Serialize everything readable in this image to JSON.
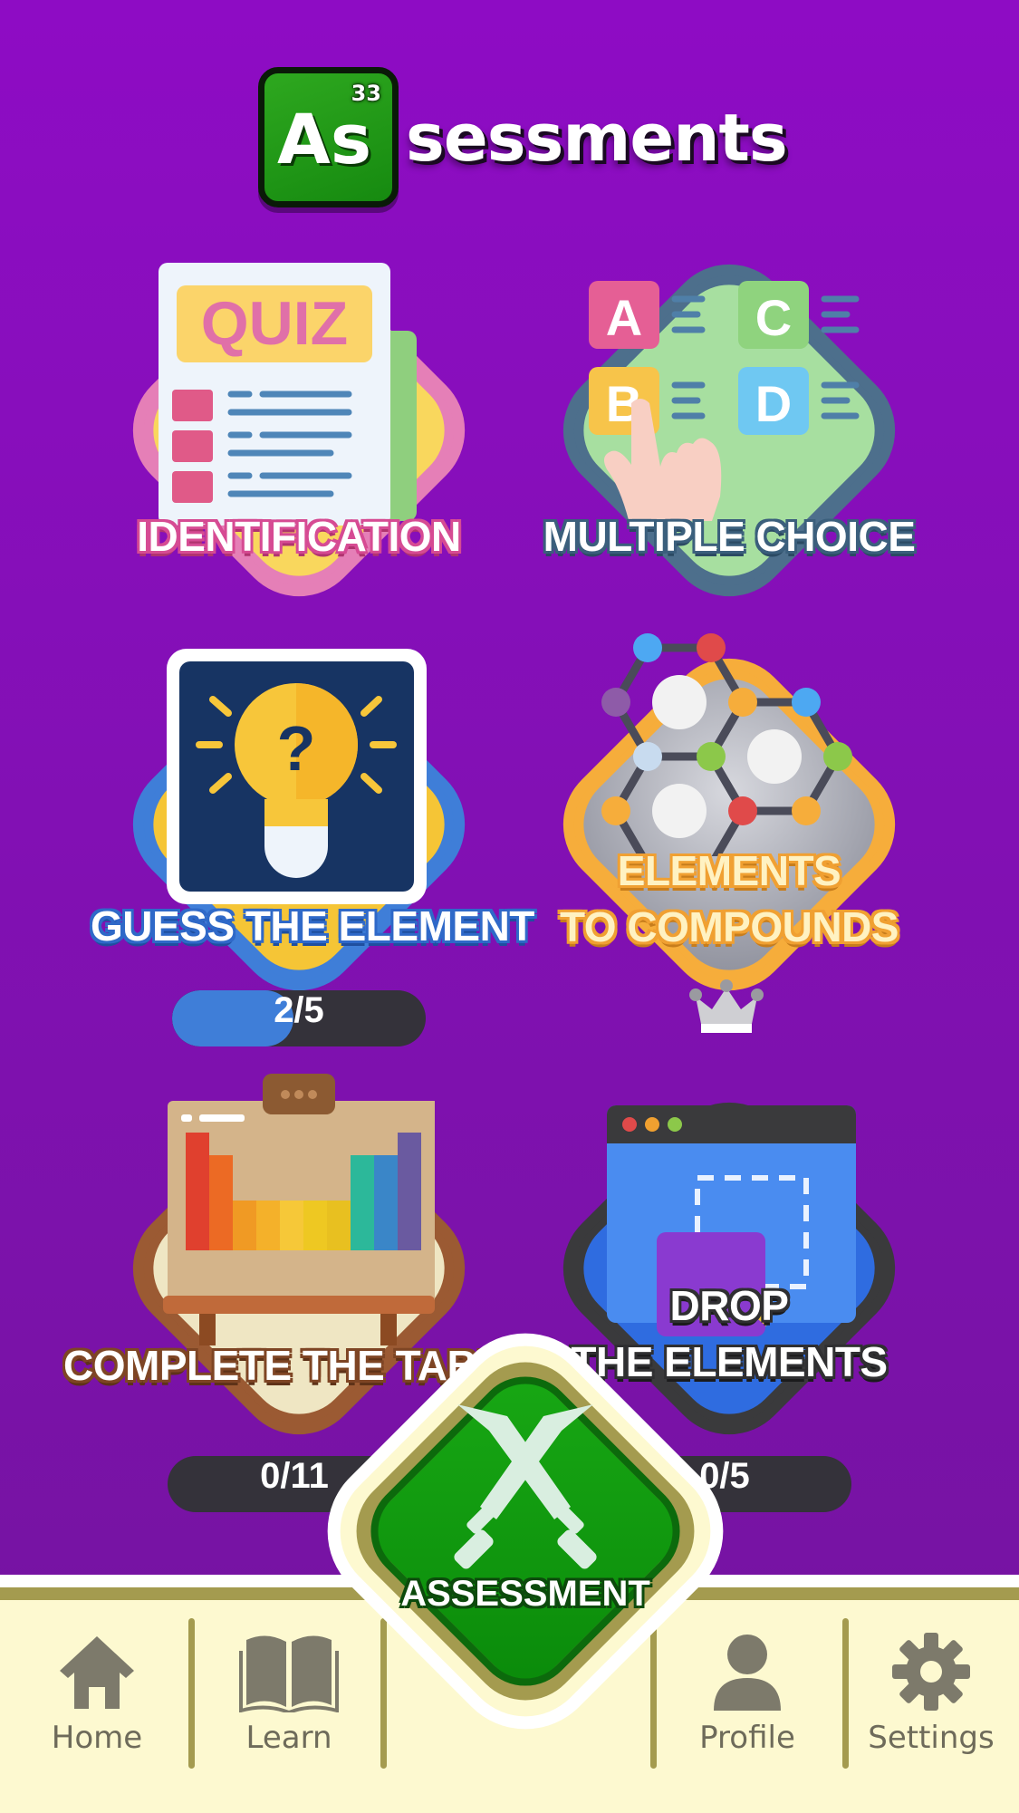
{
  "header": {
    "element_number": "33",
    "element_symbol": "As",
    "title_rest": "sessments"
  },
  "modes": {
    "identification": {
      "label": "IDENTIFICATION"
    },
    "multiple_choice": {
      "label": "MULTIPLE CHOICE"
    },
    "guess_element": {
      "label": "GUESS THE ELEMENT",
      "progress_text": "2/5",
      "progress": 0.4
    },
    "compounds": {
      "label_line1": "ELEMENTS",
      "label_line2": "TO COMPOUNDS",
      "locked": true
    },
    "complete_table": {
      "label": "COMPLETE THE TABLE",
      "progress_text": "0/11",
      "progress": 0
    },
    "drop_elements": {
      "label_line1": "DROP",
      "label_line2": "THE ELEMENTS",
      "progress_text": "0/5",
      "progress": 0
    }
  },
  "nav": {
    "home": "Home",
    "learn": "Learn",
    "assessment": "ASSESSMENT",
    "profile": "Profile",
    "settings": "Settings"
  },
  "colors": {
    "background": "#8e0cc4",
    "nav_background": "#fdf9d0",
    "nav_accent": "#a49b4f",
    "assessment_green": "#18a814"
  }
}
